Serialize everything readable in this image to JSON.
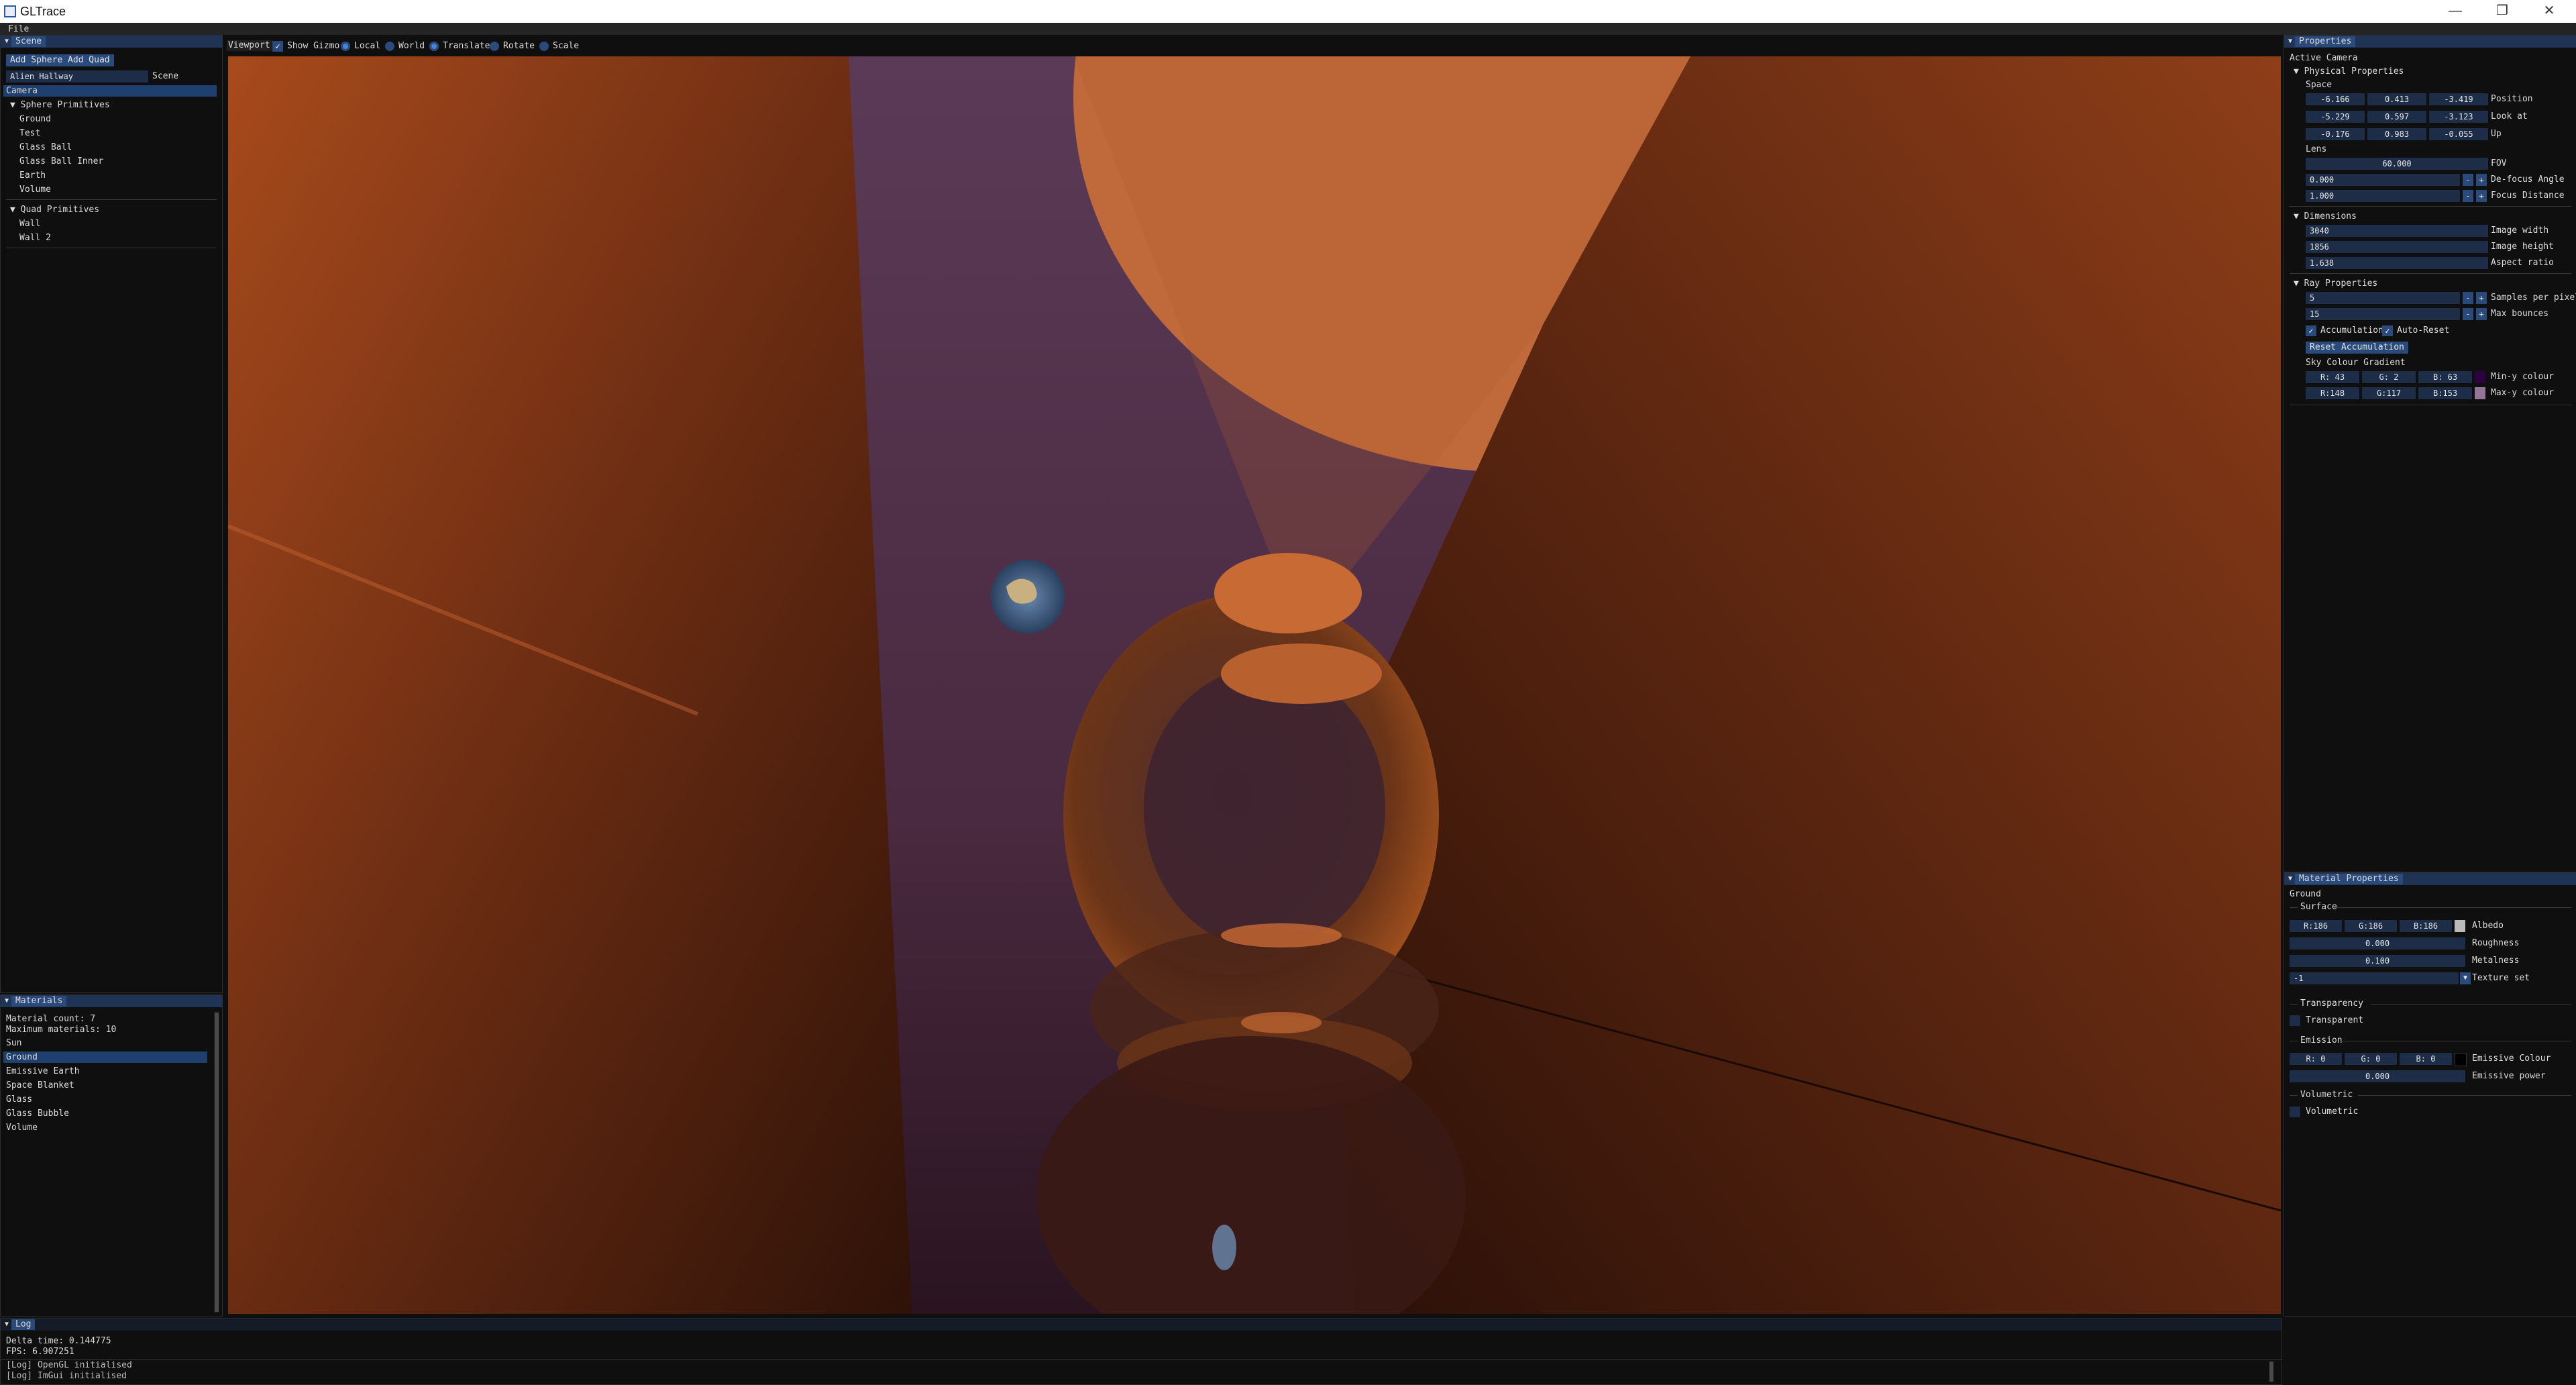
{
  "window": {
    "title": "GLTrace",
    "controls": {
      "minimize": "—",
      "restore": "❐",
      "close": "✕"
    }
  },
  "menu": {
    "file": "File"
  },
  "scene_panel": {
    "header": "Scene",
    "add_sphere": "Add Sphere",
    "add_quad": "Add Quad",
    "scene_name_value": "Alien Hallway",
    "scene_name_label": "Scene",
    "camera": "Camera",
    "sphere_group": "Sphere Primitives",
    "spheres": [
      "Ground",
      "Test",
      "Glass Ball",
      "Glass Ball Inner",
      "Earth",
      "Volume"
    ],
    "quad_group": "Quad Primitives",
    "quads": [
      "Wall",
      "Wall 2"
    ]
  },
  "materials_panel": {
    "header": "Materials",
    "count": "Material count: 7",
    "max": "Maximum materials: 10",
    "items": [
      "Sun",
      "Ground",
      "Emissive Earth",
      "Space Blanket",
      "Glass",
      "Glass Bubble",
      "Volume"
    ],
    "selected_index": 1
  },
  "log_panel": {
    "header": "Log",
    "delta": "Delta time: 0.144775",
    "fps": "FPS: 6.907251",
    "lines": [
      "[Log]    OpenGL initialised",
      "[Log]    ImGui initialised"
    ]
  },
  "viewport": {
    "tab": "Viewport",
    "show_gizmo": "Show Gizmo",
    "local": "Local",
    "world": "World",
    "translate": "Translate",
    "rotate": "Rotate",
    "scale": "Scale"
  },
  "properties_panel": {
    "header": "Properties",
    "active_camera": "Active Camera",
    "physical": "Physical Properties",
    "space": "Space",
    "position": {
      "x": "-6.166",
      "y": "0.413",
      "z": "-3.419",
      "label": "Position"
    },
    "look_at": {
      "x": "-5.229",
      "y": "0.597",
      "z": "-3.123",
      "label": "Look at"
    },
    "up": {
      "x": "-0.176",
      "y": "0.983",
      "z": "-0.055",
      "label": "Up"
    },
    "lens": "Lens",
    "fov": {
      "value": "60.000",
      "label": "FOV"
    },
    "defocus": {
      "value": "0.000",
      "label": "De-focus Angle"
    },
    "focus": {
      "value": "1.000",
      "label": "Focus Distance"
    },
    "dimensions": "Dimensions",
    "width": {
      "value": "3040",
      "label": "Image width"
    },
    "height": {
      "value": "1856",
      "label": "Image height"
    },
    "aspect": {
      "value": "1.638",
      "label": "Aspect ratio"
    },
    "ray": "Ray Properties",
    "spp": {
      "value": "5",
      "label": "Samples per pixel"
    },
    "bounces": {
      "value": "15",
      "label": "Max bounces"
    },
    "accumulation": "Accumulation",
    "auto_reset": "Auto-Reset",
    "reset_button": "Reset Accumulation",
    "sky_gradient": "Sky Colour Gradient",
    "min_y": {
      "r": "R: 43",
      "g": "G: 2",
      "b": "B: 63",
      "label": "Min-y colour",
      "color": "#2b023f"
    },
    "max_y": {
      "r": "R:148",
      "g": "G:117",
      "b": "B:153",
      "label": "Max-y colour",
      "color": "#947599"
    },
    "minus": "-",
    "plus": "+"
  },
  "material_props": {
    "header": "Material Properties",
    "name": "Ground",
    "surface": "Surface",
    "albedo": {
      "r": "R:186",
      "g": "G:186",
      "b": "B:186",
      "label": "Albedo",
      "color": "#bababa"
    },
    "roughness": {
      "value": "0.000",
      "label": "Roughness"
    },
    "metalness": {
      "value": "0.100",
      "label": "Metalness"
    },
    "texture": {
      "value": "-1",
      "label": "Texture set"
    },
    "transparency": "Transparency",
    "transparent": "Transparent",
    "emission": "Emission",
    "emissive_colour": {
      "r": "R: 0",
      "g": "G: 0",
      "b": "B: 0",
      "label": "Emissive Colour",
      "color": "#000000"
    },
    "emissive_power": {
      "value": "0.000",
      "label": "Emissive power"
    },
    "volumetric_section": "Volumetric",
    "volumetric": "Volumetric"
  },
  "colors": {
    "accent": "#294a7a",
    "header": "#1f3354",
    "field": "#1d2d48"
  }
}
